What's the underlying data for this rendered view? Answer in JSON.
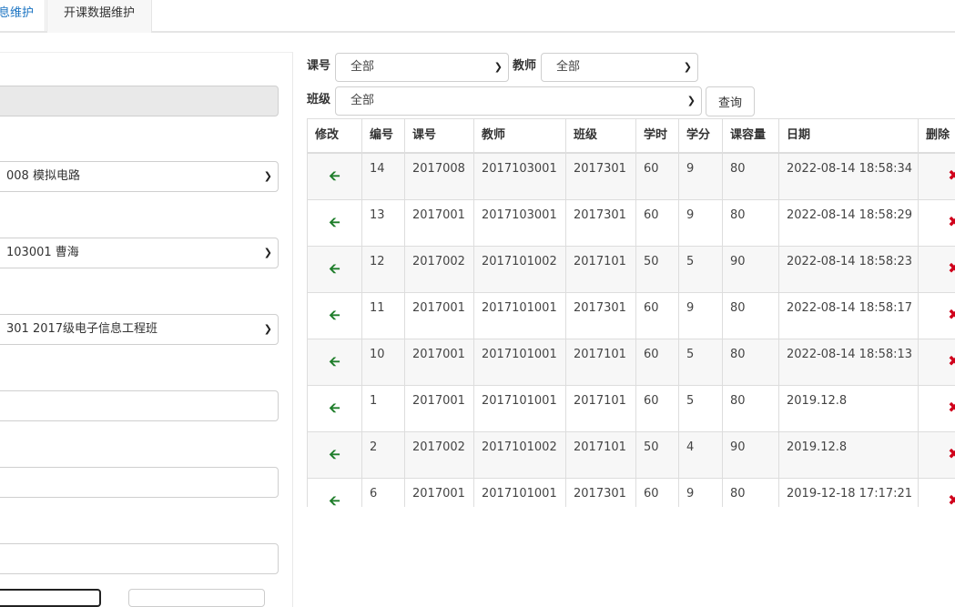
{
  "tabs": [
    {
      "label": "息维护"
    },
    {
      "label": "开课数据维护"
    }
  ],
  "left_form": {
    "course_value": "008 模拟电路",
    "teacher_value": "103001 曹海",
    "class_value": "301 2017级电子信息工程班"
  },
  "filters": {
    "course_label": "课号",
    "course_value": "全部",
    "teacher_label": "教师",
    "teacher_value": "全部",
    "class_label": "班级",
    "class_value": "全部",
    "query_label": "查询"
  },
  "table": {
    "headers": [
      "修改",
      "编号",
      "课号",
      "教师",
      "班级",
      "学时",
      "学分",
      "课容量",
      "日期",
      "删除"
    ],
    "rows": [
      {
        "id": "14",
        "course": "2017008",
        "teacher": "2017103001",
        "class": "2017301",
        "hours": "60",
        "credit": "9",
        "capacity": "80",
        "date": "2022-08-14 18:58:34"
      },
      {
        "id": "13",
        "course": "2017001",
        "teacher": "2017103001",
        "class": "2017301",
        "hours": "60",
        "credit": "9",
        "capacity": "80",
        "date": "2022-08-14 18:58:29"
      },
      {
        "id": "12",
        "course": "2017002",
        "teacher": "2017101002",
        "class": "2017101",
        "hours": "50",
        "credit": "5",
        "capacity": "90",
        "date": "2022-08-14 18:58:23"
      },
      {
        "id": "11",
        "course": "2017001",
        "teacher": "2017101001",
        "class": "2017301",
        "hours": "60",
        "credit": "9",
        "capacity": "80",
        "date": "2022-08-14 18:58:17"
      },
      {
        "id": "10",
        "course": "2017001",
        "teacher": "2017101001",
        "class": "2017101",
        "hours": "60",
        "credit": "5",
        "capacity": "80",
        "date": "2022-08-14 18:58:13"
      },
      {
        "id": "1",
        "course": "2017001",
        "teacher": "2017101001",
        "class": "2017101",
        "hours": "60",
        "credit": "5",
        "capacity": "80",
        "date": "2019.12.8"
      },
      {
        "id": "2",
        "course": "2017002",
        "teacher": "2017101002",
        "class": "2017101",
        "hours": "50",
        "credit": "4",
        "capacity": "90",
        "date": "2019.12.8"
      },
      {
        "id": "6",
        "course": "2017001",
        "teacher": "2017101001",
        "class": "2017301",
        "hours": "60",
        "credit": "9",
        "capacity": "80",
        "date": "2019-12-18 17:17:21"
      }
    ]
  },
  "icons": {
    "edit": "left-arrow-icon",
    "delete": "cross-icon"
  },
  "colors": {
    "edit_icon": "#1e7d2a",
    "delete_icon": "#d0021b",
    "active_tab": "#1a73c2"
  }
}
